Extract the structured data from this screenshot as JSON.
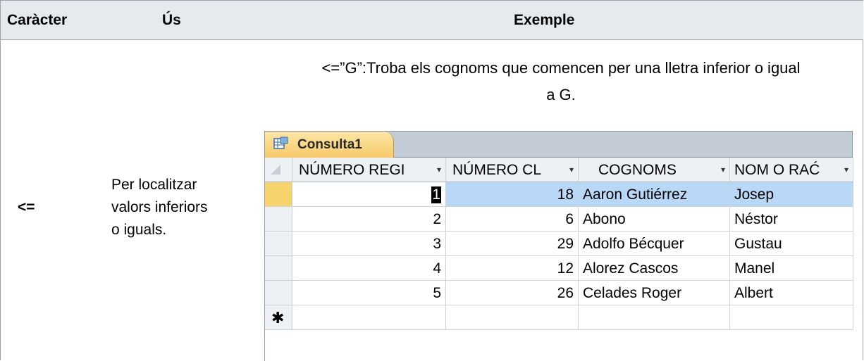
{
  "table": {
    "headers": [
      "Caràcter",
      "Ús",
      "Exemple"
    ],
    "row": {
      "character": "<=",
      "usage_lines": [
        "Per localitzar",
        "valors inferiors",
        "o iguals."
      ],
      "example_caption_lines": [
        "<=”G”:Troba els cognoms que comencen per una lletra inferior o igual",
        "a G."
      ]
    }
  },
  "datasheet": {
    "tab_label": "Consulta1",
    "tab_icon": "query-datasheet-icon",
    "columns": [
      "NÚMERO REGI",
      "NÚMERO CL",
      "COGNOMS",
      "NOM O RAĆ"
    ],
    "dropdown_glyph": "▾",
    "rows": [
      [
        "1",
        "18",
        "Aaron Gutiérrez",
        "Josep"
      ],
      [
        "2",
        "6",
        "Abono",
        "Néstor"
      ],
      [
        "3",
        "29",
        "Adolfo Bécquer",
        "Gustau"
      ],
      [
        "4",
        "12",
        "Alorez Cascos",
        "Manel"
      ],
      [
        "5",
        "26",
        "Celades Roger",
        "Albert"
      ]
    ],
    "new_record_marker": "✱",
    "selected_row_color": "#b9d7f6",
    "record_selector_color": "#f7d36b"
  }
}
